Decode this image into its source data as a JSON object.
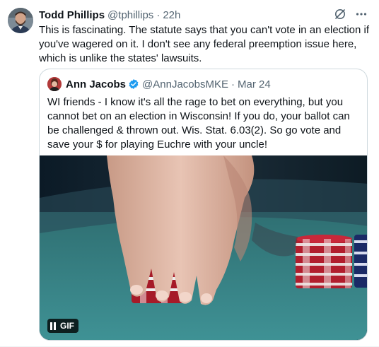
{
  "tweet": {
    "author_name": "Todd Phillips",
    "author_handle": "@tphillips",
    "separator": "·",
    "timestamp": "22h",
    "text": "This is fascinating. The statute says that you can't vote in an election if you've wagered on it. I don't see any federal preemption issue here, which is unlike the states' lawsuits."
  },
  "quoted_tweet": {
    "author_name": "Ann Jacobs",
    "verified": true,
    "author_handle": "@AnnJacobsMKE",
    "separator": "·",
    "timestamp": "Mar 24",
    "text": "WI friends - I know it's all the rage to bet on everything, but you cannot bet on an election in Wisconsin!  If you do, your ballot can be challenged & thrown out.  Wis. Stat. 6.03(2). So go vote and save your $ for playing Euchre with your uncle!",
    "media": {
      "type": "gif",
      "badge_label": "GIF"
    }
  },
  "icons": {
    "grok": "grok-icon",
    "more": "more-icon",
    "verified": "verified-badge-icon",
    "pause": "pause-icon"
  },
  "colors": {
    "text": "#0f1419",
    "secondary": "#536471",
    "verified_blue": "#1d9bf0",
    "border": "#cfd9de"
  }
}
